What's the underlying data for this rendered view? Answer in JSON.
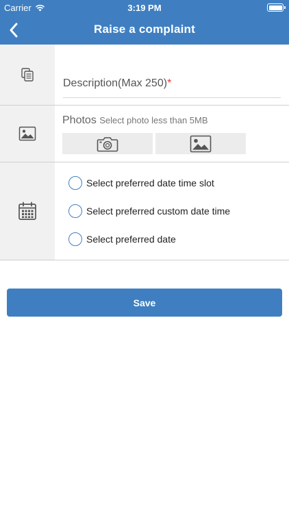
{
  "status_bar": {
    "carrier": "Carrier",
    "time": "3:19 PM",
    "battery_level": 1.0
  },
  "nav": {
    "title": "Raise a complaint"
  },
  "description": {
    "placeholder": "Description(Max 250)",
    "required_mark": "*"
  },
  "photos": {
    "label": "Photos",
    "hint": "Select photo less than 5MB"
  },
  "date_options": [
    {
      "label": "Select preferred date time slot",
      "selected": false
    },
    {
      "label": "Select preferred custom date time",
      "selected": false
    },
    {
      "label": "Select preferred date",
      "selected": false
    }
  ],
  "save_label": "Save",
  "colors": {
    "primary": "#3f7fc1",
    "required": "#e53935",
    "gutter": "#f1f1f1"
  }
}
